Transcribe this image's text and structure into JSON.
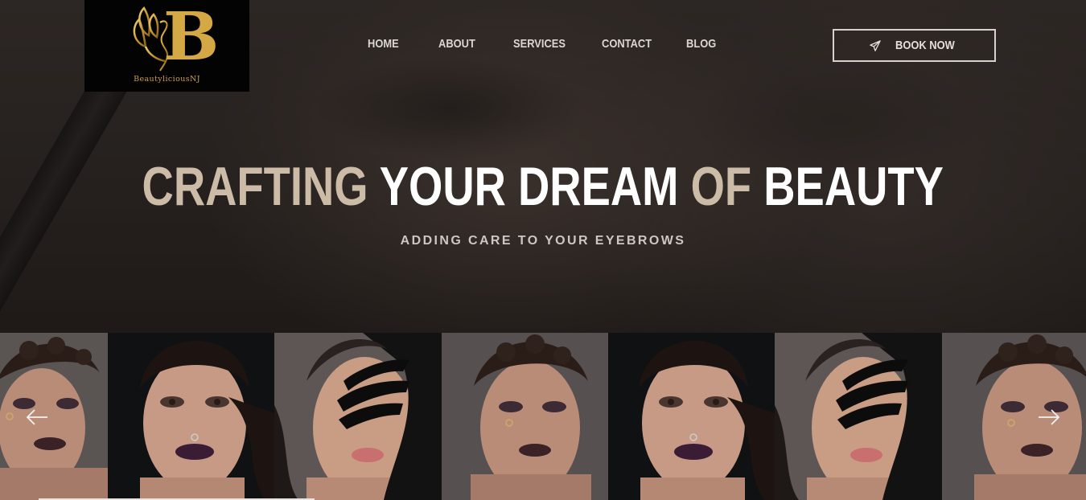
{
  "logo": {
    "letter": "B",
    "name": "BeautyliciousNJ"
  },
  "nav": {
    "items": [
      {
        "label": "HOME"
      },
      {
        "label": "ABOUT"
      },
      {
        "label": "SERVICES"
      },
      {
        "label": "CONTACT"
      },
      {
        "label": "BLOG"
      }
    ],
    "book_label": "BOOK NOW",
    "book_icon": "paper-plane-icon"
  },
  "hero": {
    "headline": {
      "word1": "CRAFTING",
      "word2": "YOUR DREAM",
      "word3": "OF",
      "word4": "BEAUTY"
    },
    "subtitle": "ADDING CARE TO YOUR EYEBROWS"
  },
  "gallery": {
    "prev_icon": "arrow-left-icon",
    "next_icon": "arrow-right-icon",
    "photos": [
      {
        "subject": "model-glitter-lips"
      },
      {
        "subject": "model-purple-lips"
      },
      {
        "subject": "model-black-paint"
      },
      {
        "subject": "model-glitter-lips"
      },
      {
        "subject": "model-purple-lips"
      },
      {
        "subject": "model-black-paint"
      },
      {
        "subject": "model-glitter-lips"
      }
    ]
  },
  "colors": {
    "accent_tan": "#cbbba7",
    "gold": "#c9a04b",
    "logo_bg": "#030303"
  }
}
